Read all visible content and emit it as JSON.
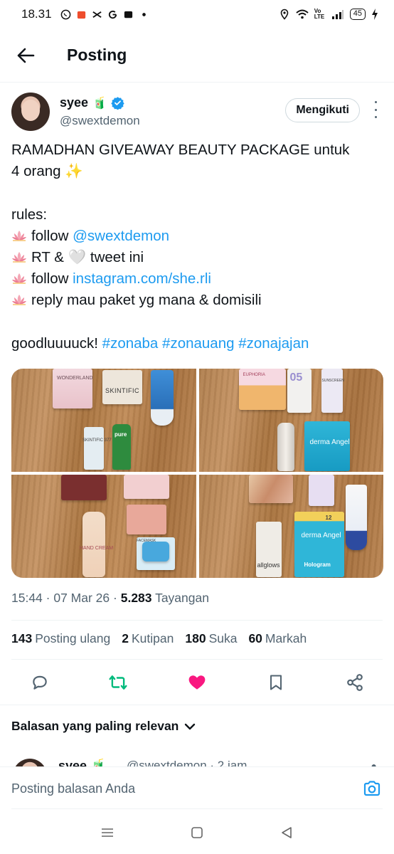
{
  "status_bar": {
    "time": "18.31",
    "network_label": "Vo LTE",
    "battery": "45"
  },
  "header": {
    "title": "Posting"
  },
  "tweet": {
    "author": {
      "display_name": "syee",
      "name_emoji": "🧃",
      "handle": "@swextdemon"
    },
    "follow_label": "Mengikuti",
    "text": {
      "line1": "RAMADHAN GIVEAWAY BEAUTY PACKAGE untuk",
      "line2_text": "4 orang",
      "line2_emoji": "✨",
      "rules_heading": "rules:",
      "rule1_prefix": "follow",
      "rule1_link": "@swextdemon",
      "rule2_prefix": "RT &",
      "rule2_emoji": "🤍",
      "rule2_suffix": "tweet ini",
      "rule3_prefix": "follow",
      "rule3_link": "instagram.com/she.rli",
      "rule4": "reply mau paket yg mana & domisili",
      "closing": "goodluuuuck!",
      "hashtag1": "#zonaba",
      "hashtag2": "#zonauang",
      "hashtag3": "#zonajajan"
    },
    "media": {
      "photo1_labels": [
        "WONDERLAND",
        "SKINTIFIC",
        "SKINTIFIC 377",
        "pure"
      ],
      "photo2_labels": [
        "EUPHORIA",
        "05",
        "SUNSCREEN",
        "derma Angel"
      ],
      "photo3_labels": [
        "HAND CREAM",
        "FACEMASK"
      ],
      "photo4_labels": [
        "allglows",
        "derma Angel",
        "Hologram",
        "12"
      ]
    },
    "meta": {
      "time": "15:44",
      "date": "07 Mar 26",
      "views_count": "5.283",
      "views_label": "Tayangan"
    },
    "stats": {
      "reposts_count": "143",
      "reposts_label": "Posting ulang",
      "quotes_count": "2",
      "quotes_label": "Kutipan",
      "likes_count": "180",
      "likes_label": "Suka",
      "bookmarks_count": "60",
      "bookmarks_label": "Markah"
    }
  },
  "replies": {
    "sort_label": "Balasan yang paling relevan",
    "peek": {
      "display_name": "syee 🧃",
      "handle_time": "@swextdemon · 2 jam"
    }
  },
  "composer": {
    "placeholder": "Posting balasan Anda"
  },
  "colors": {
    "link": "#1d9bf0",
    "repost_active": "#00ba7c",
    "like_active": "#f91880",
    "secondary_text": "#536471"
  }
}
